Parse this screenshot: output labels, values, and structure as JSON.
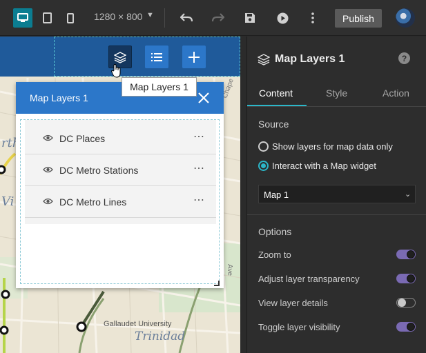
{
  "toolbar": {
    "resolution": "1280 × 800",
    "publish_label": "Publish",
    "icons": [
      "desktop-icon",
      "tablet-icon",
      "phone-icon",
      "undo-icon",
      "redo-icon",
      "save-icon",
      "preview-icon",
      "more-icon"
    ]
  },
  "map": {
    "tooltip": "Map Layers 1",
    "place_labels": [
      "Gallaudet University",
      "Trinidad"
    ]
  },
  "widget": {
    "title": "Map Layers 1",
    "layers": [
      {
        "label": "DC Places"
      },
      {
        "label": "DC Metro Stations"
      },
      {
        "label": "DC Metro Lines"
      }
    ]
  },
  "panel": {
    "title": "Map Layers 1",
    "tabs": [
      "Content",
      "Style",
      "Action"
    ],
    "active_tab": "Content",
    "source_label": "Source",
    "source_options": [
      {
        "label": "Show layers for map data only",
        "selected": false
      },
      {
        "label": "Interact with a Map widget",
        "selected": true
      }
    ],
    "map_select": "Map 1",
    "options_label": "Options",
    "options": [
      {
        "label": "Zoom to",
        "on": true
      },
      {
        "label": "Adjust layer transparency",
        "on": true
      },
      {
        "label": "View layer details",
        "on": false
      },
      {
        "label": "Toggle layer visibility",
        "on": true
      }
    ]
  },
  "colors": {
    "accent_teal": "#2bb7c9",
    "toggle_on": "#7a6ab3",
    "widget_blue": "#2c77c9",
    "map_header": "#1f5a9a"
  }
}
